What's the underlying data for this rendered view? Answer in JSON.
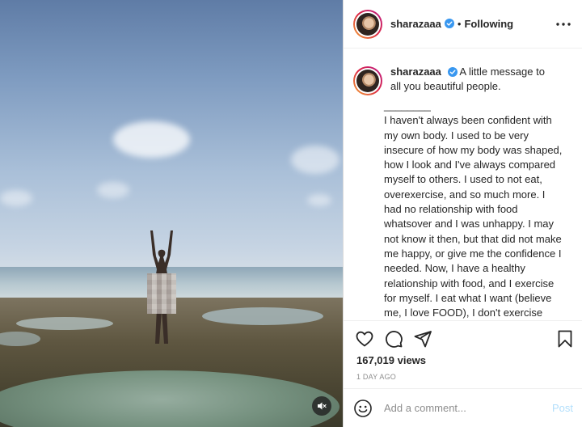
{
  "media": {
    "mute_icon": "speaker-muted-icon"
  },
  "header": {
    "username": "sharazaaa",
    "separator": "•",
    "follow_status": "Following",
    "more_icon": "more-options-icon"
  },
  "caption": {
    "username": "sharazaaa",
    "headline": "A little message to all you beautiful people.",
    "body": "________\nI haven't always been confident with my own body. I used to be very insecure of how my body was shaped, how I look and I've always compared myself to others. I used to not eat, overexercise, and so much more. I had no relationship with food whatsover and I was unhappy. I may not know it then, but that did not make me happy, or give me the confidence I needed. Now, I have a healthy relationship with food, and I exercise for myself. I eat what I want (believe me, I love FOOD), I don't exercise when I don't want to and I listen to my body more. I got my confidence back and am now happy,"
  },
  "actions": {
    "like_icon": "heart-icon",
    "comment_icon": "comment-icon",
    "share_icon": "send-icon",
    "save_icon": "bookmark-icon"
  },
  "stats": {
    "views": "167,019 views",
    "time": "1 DAY AGO"
  },
  "comment": {
    "placeholder": "Add a comment...",
    "post_label": "Post",
    "emoji_icon": "emoji-icon"
  },
  "colors": {
    "verified": "#3897f0",
    "post_disabled": "#b2dffc",
    "muted_text": "#8e8e8e"
  }
}
